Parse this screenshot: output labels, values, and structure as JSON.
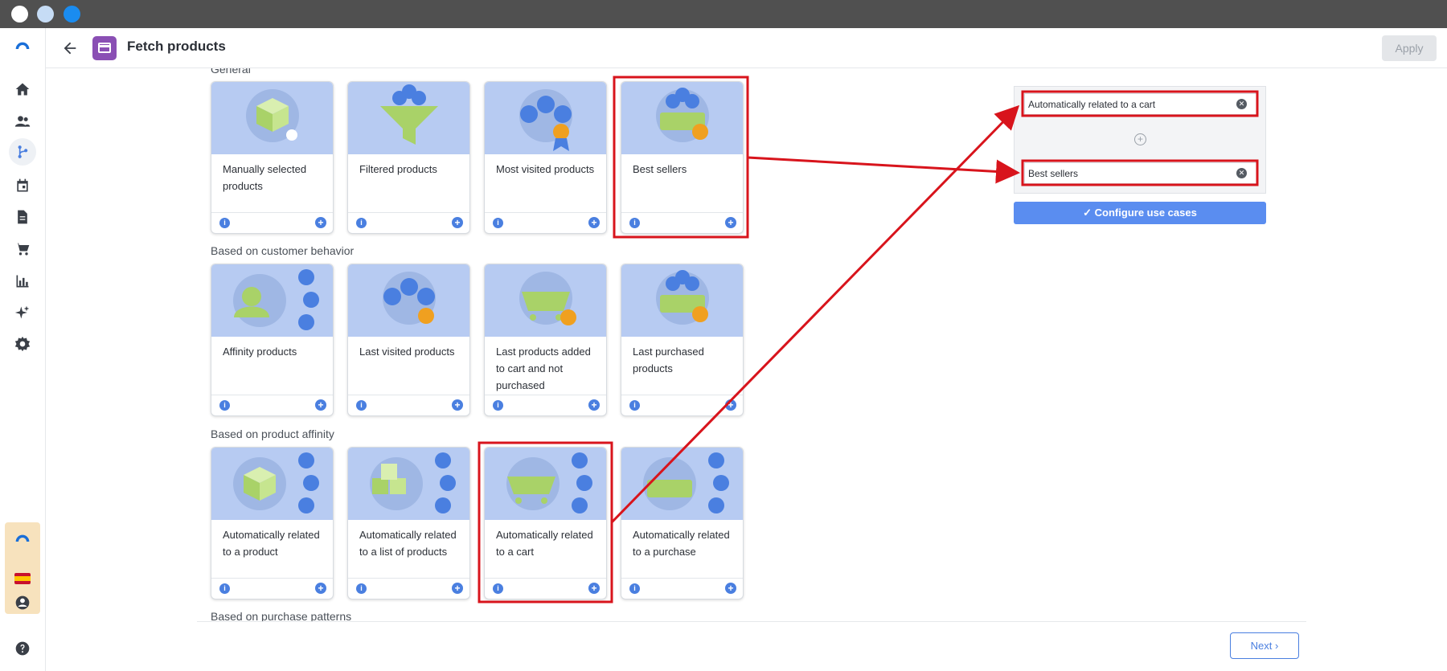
{
  "header": {
    "title": "Fetch products",
    "apply_label": "Apply"
  },
  "sections": [
    {
      "title": "General"
    },
    {
      "title": "Based on customer behavior"
    },
    {
      "title": "Based on product affinity"
    },
    {
      "title": "Based on purchase patterns"
    }
  ],
  "cards": {
    "general": [
      "Manually selected products",
      "Filtered products",
      "Most visited products",
      "Best sellers"
    ],
    "customer": [
      "Affinity products",
      "Last visited products",
      "Last products added to cart and not purchased",
      "Last purchased products"
    ],
    "affinity": [
      "Automatically related to a product",
      "Automatically related to a list of products",
      "Automatically related to a cart",
      "Automatically related to a purchase"
    ]
  },
  "card_controls": {
    "info": "i",
    "add": "+"
  },
  "panel": {
    "slot1": "Automatically related to a cart",
    "slot2": "Best sellers",
    "configure_label": "✓ Configure use cases"
  },
  "footer": {
    "next_label": "Next ›"
  },
  "colors": {
    "accent": "#4a7fe0",
    "highlight": "#d8141c",
    "card_image_bg": "#b7cbf2"
  }
}
